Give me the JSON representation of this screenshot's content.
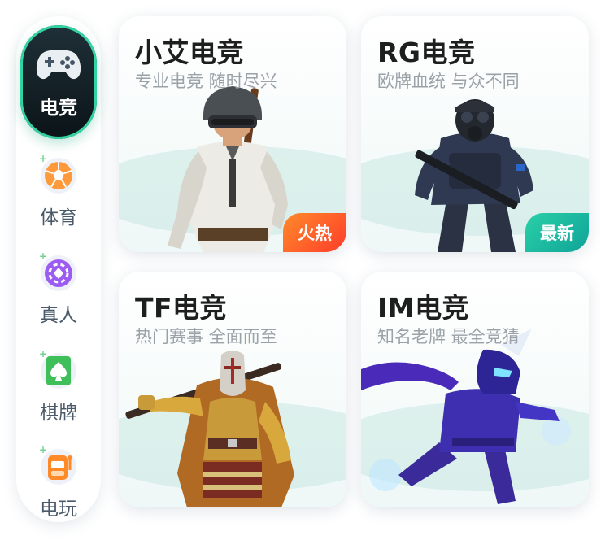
{
  "sidebar": {
    "items": [
      {
        "label": "电竞",
        "icon": "gamepad-icon",
        "active": true
      },
      {
        "label": "体育",
        "icon": "soccer-ball-icon"
      },
      {
        "label": "真人",
        "icon": "casino-chip-icon"
      },
      {
        "label": "棋牌",
        "icon": "spade-card-icon"
      },
      {
        "label": "电玩",
        "icon": "slot-machine-icon"
      }
    ]
  },
  "cards": [
    {
      "title": "小艾电竞",
      "subtitle": "专业电竞 随时尽兴",
      "badge": "火热",
      "image": "helmeted-soldier-illustration"
    },
    {
      "title": "RG电竞",
      "subtitle": "欧牌血统 与众不同",
      "badge": "最新",
      "image": "swat-soldier-illustration"
    },
    {
      "title": "TF电竞",
      "subtitle": "热门赛事 全面而至",
      "image": "armored-warrior-illustration"
    },
    {
      "title": "IM电竞",
      "subtitle": "知名老牌 最全竞猜",
      "image": "ninja-hero-illustration"
    }
  ],
  "colors": {
    "accent": "#31d3a2",
    "hot_badge": "#ff5a2a",
    "new_badge": "#17b8a0"
  }
}
